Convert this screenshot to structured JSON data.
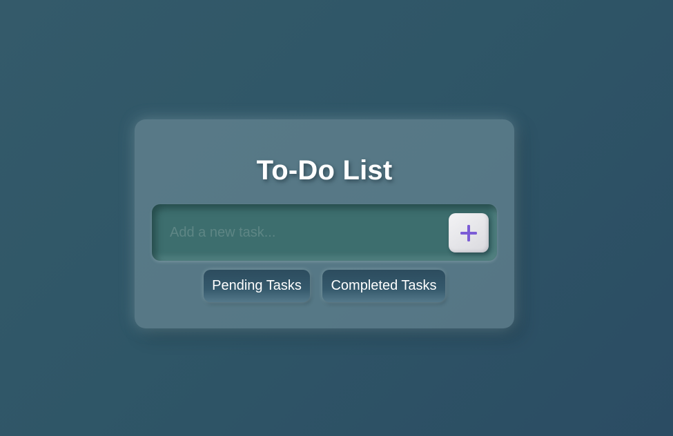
{
  "app": {
    "title": "To-Do List"
  },
  "input": {
    "placeholder": "Add a new task...",
    "value": "",
    "add_button": {
      "icon": "plus-icon",
      "icon_color": "#7b5cd6"
    }
  },
  "filters": [
    {
      "label": "Pending Tasks"
    },
    {
      "label": "Completed Tasks"
    }
  ],
  "colors": {
    "accent": "#7b5cd6",
    "input_background": "#3d6e6e",
    "button_background": "#2f5163"
  }
}
